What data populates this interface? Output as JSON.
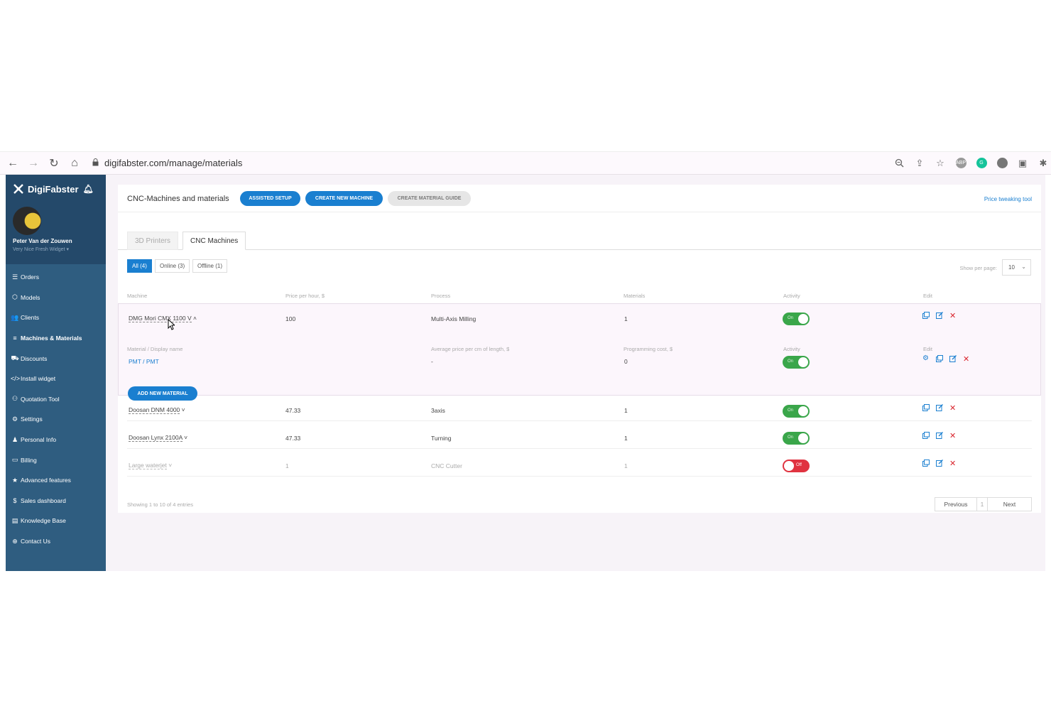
{
  "browser": {
    "url": "digifabster.com/manage/materials",
    "extensions": [
      "ABP",
      "G"
    ]
  },
  "sidebar": {
    "brand": "DigiFabster",
    "user_name": "Peter Van der Zouwen",
    "user_sub": "Very Nice Fresh Widget ▾",
    "items": [
      {
        "label": "Orders",
        "icon": "list-icon",
        "glyph": "☰"
      },
      {
        "label": "Models",
        "icon": "cubes-icon",
        "glyph": "⬡"
      },
      {
        "label": "Clients",
        "icon": "users-icon",
        "glyph": "👥"
      },
      {
        "label": "Machines & Materials",
        "icon": "bars-icon",
        "glyph": "≡"
      },
      {
        "label": "Discounts",
        "icon": "cart-icon",
        "glyph": "⛟"
      },
      {
        "label": "Install widget",
        "icon": "code-icon",
        "glyph": "</>"
      },
      {
        "label": "Quotation Tool",
        "icon": "user-icon",
        "glyph": "⚇"
      },
      {
        "label": "Settings",
        "icon": "gear-icon",
        "glyph": "⚙"
      },
      {
        "label": "Personal Info",
        "icon": "person-icon",
        "glyph": "♟"
      },
      {
        "label": "Billing",
        "icon": "credit-card-icon",
        "glyph": "▭"
      },
      {
        "label": "Advanced features",
        "icon": "star-icon",
        "glyph": "★"
      },
      {
        "label": "Sales dashboard",
        "icon": "dollar-icon",
        "glyph": "$"
      },
      {
        "label": "Knowledge Base",
        "icon": "book-icon",
        "glyph": "▤"
      },
      {
        "label": "Contact Us",
        "icon": "lifebuoy-icon",
        "glyph": "⊕"
      }
    ]
  },
  "header": {
    "title": "CNC-Machines and materials",
    "assisted_setup": "ASSISTED SETUP",
    "create_machine": "CREATE NEW MACHINE",
    "create_guide": "CREATE MATERIAL GUIDE",
    "tweak_link": "Price tweaking tool"
  },
  "tabs": [
    "3D Printers",
    "CNC Machines"
  ],
  "filters": [
    "All (4)",
    "Online (3)",
    "Offline (1)"
  ],
  "per_page": {
    "label": "Show per page:",
    "value": "10"
  },
  "table": {
    "headers": [
      "Machine",
      "Price per hour, $",
      "Process",
      "Materials",
      "Activity",
      "Edit"
    ],
    "sub_headers": [
      "Material / Display name",
      "Average price per cm of length, $",
      "Programming cost, $",
      "Activity",
      "Edit"
    ],
    "toggle_on": "On",
    "toggle_off": "Off",
    "rows": [
      {
        "machine": "DMG Mori CMX 1100 V",
        "price": "100",
        "process": "Multi-Axis Milling",
        "materials": "1"
      },
      {
        "machine": "Doosan DNM 4000",
        "price": "47.33",
        "process": "3axis",
        "materials": "1"
      },
      {
        "machine": "Doosan Lynx 2100A",
        "price": "47.33",
        "process": "Turning",
        "materials": "1"
      },
      {
        "machine": "Large waterjet",
        "price": "1",
        "process": "CNC Cutter",
        "materials": "1"
      }
    ],
    "material_row": {
      "name": "PMT / PMT",
      "avg_price": "-",
      "programming_cost": "0"
    },
    "add_material": "ADD NEW MATERIAL"
  },
  "footer": {
    "showing": "Showing 1 to 10 of 4 entries",
    "previous": "Previous",
    "page": "1",
    "next": "Next"
  },
  "colors": {
    "accent": "#1a7fd0",
    "sidebar": "#2f5d80",
    "toggle_on": "#3aa64a",
    "toggle_off": "#e03340",
    "delete": "#d9262e"
  }
}
